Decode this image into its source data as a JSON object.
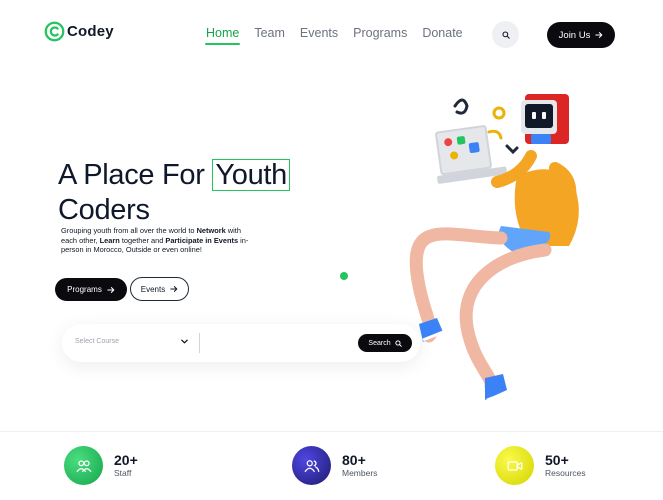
{
  "brand": {
    "name": "Codey",
    "accent": "#22c55e"
  },
  "nav": {
    "items": [
      {
        "label": "Home",
        "active": true
      },
      {
        "label": "Team",
        "active": false
      },
      {
        "label": "Events",
        "active": false
      },
      {
        "label": "Programs",
        "active": false
      },
      {
        "label": "Donate",
        "active": false
      }
    ],
    "search_icon": "search-icon",
    "join_label": "Join Us"
  },
  "hero": {
    "title_pre": "A Place For ",
    "title_highlight": "Youth",
    "title_line2": "Coders",
    "desc": {
      "p1": "Grouping youth from all over the world to ",
      "b1": "Network",
      "p2": " with each other, ",
      "b2": "Learn",
      "p3": " together and ",
      "b3": "Participate in Events",
      "p4": " in-person in Morocco, Outside or even online!"
    },
    "programs_btn": "Programs",
    "events_btn": "Events"
  },
  "course_search": {
    "placeholder": "Select Course",
    "search_btn": "Search"
  },
  "stats": [
    {
      "number": "20+",
      "label": "Staff",
      "icon": "users-icon",
      "color": "#22c55e"
    },
    {
      "number": "80+",
      "label": "Members",
      "icon": "group-icon",
      "color": "#3730a3"
    },
    {
      "number": "50+",
      "label": "Resources",
      "icon": "video-icon",
      "color": "#e5e500"
    }
  ]
}
